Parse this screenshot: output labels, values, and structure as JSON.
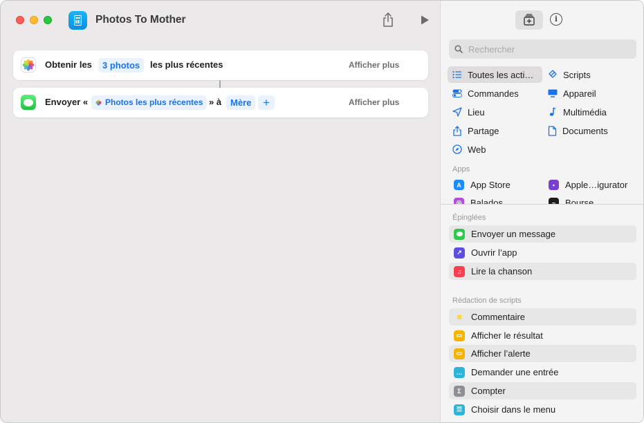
{
  "window": {
    "title": "Photos To Mother"
  },
  "workflow": {
    "action1": {
      "prefix": "Obtenir les",
      "token": "3 photos",
      "suffix": "les plus récentes",
      "show_more": "Afficher plus"
    },
    "action2": {
      "prefix": "Envoyer «",
      "token": "Photos les plus récentes",
      "middle": "» à",
      "recipient": "Mère",
      "add": "+",
      "show_more": "Afficher plus"
    }
  },
  "sidebar": {
    "search_placeholder": "Rechercher",
    "categories": [
      {
        "label": "Toutes les acti…",
        "icon": "list-icon",
        "selected": true
      },
      {
        "label": "Scripts",
        "icon": "scripts-icon"
      },
      {
        "label": "Commandes",
        "icon": "toggles-icon"
      },
      {
        "label": "Appareil",
        "icon": "display-icon"
      },
      {
        "label": "Lieu",
        "icon": "location-arrow-icon"
      },
      {
        "label": "Multimédia",
        "icon": "music-note-icon"
      },
      {
        "label": "Partage",
        "icon": "share-icon"
      },
      {
        "label": "Documents",
        "icon": "document-icon"
      },
      {
        "label": "Web",
        "icon": "compass-icon"
      }
    ],
    "apps_label": "Apps",
    "apps": [
      {
        "label": "App Store",
        "icon": "app-store-icon",
        "color": "#1a8cff"
      },
      {
        "label": "Apple…igurator",
        "icon": "apple-configurator-icon",
        "color": "#7a3fd1"
      },
      {
        "label": "Balados",
        "icon": "podcasts-icon",
        "color": "#b050e0"
      },
      {
        "label": "Bourse",
        "icon": "stocks-icon",
        "color": "#1c1c1e"
      }
    ],
    "pinned_label": "Épinglées",
    "pinned": [
      {
        "label": "Envoyer un message",
        "icon": "messages-icon",
        "color": "#2ec84a"
      },
      {
        "label": "Ouvrir l’app",
        "icon": "open-app-icon",
        "color": "#5b4fe0"
      },
      {
        "label": "Lire la chanson",
        "icon": "music-icon",
        "color": "#fa3d4f"
      }
    ],
    "scripting_label": "Rédaction de scripts",
    "scripting": [
      {
        "label": "Commentaire",
        "icon": "comment-icon",
        "color": "#f5c400"
      },
      {
        "label": "Afficher le résultat",
        "icon": "show-result-icon",
        "color": "#f5b400"
      },
      {
        "label": "Afficher l’alerte",
        "icon": "alert-icon",
        "color": "#f5b400"
      },
      {
        "label": "Demander une entrée",
        "icon": "ask-input-icon",
        "color": "#2db5d9"
      },
      {
        "label": "Compter",
        "icon": "sigma-icon",
        "color": "#8e8e93"
      },
      {
        "label": "Choisir dans le menu",
        "icon": "menu-icon",
        "color": "#2db5d9"
      }
    ]
  }
}
